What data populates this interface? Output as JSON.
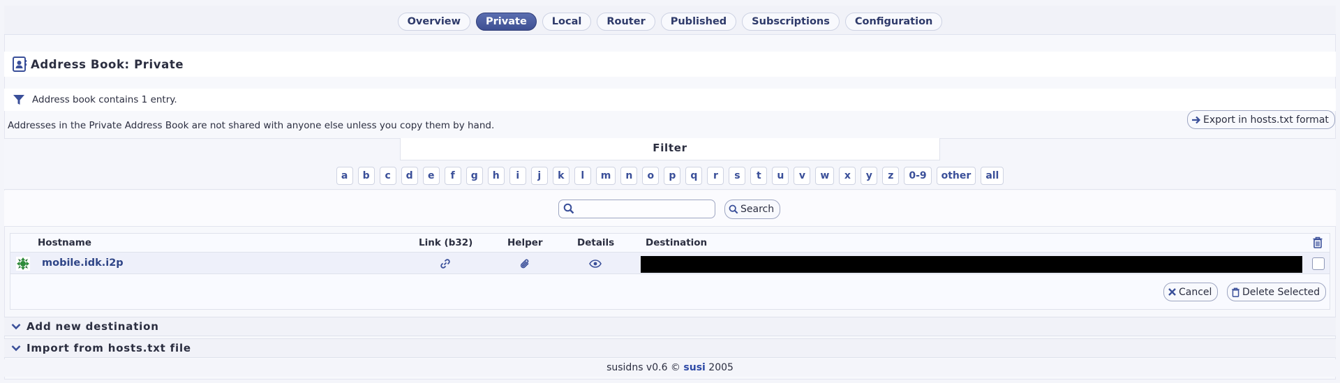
{
  "nav": {
    "tabs": [
      {
        "label": "Overview",
        "active": false
      },
      {
        "label": "Private",
        "active": true
      },
      {
        "label": "Local",
        "active": false
      },
      {
        "label": "Router",
        "active": false
      },
      {
        "label": "Published",
        "active": false
      },
      {
        "label": "Subscriptions",
        "active": false
      },
      {
        "label": "Configuration",
        "active": false
      }
    ]
  },
  "header": {
    "title": "Address Book: Private",
    "icon": "address-book-icon"
  },
  "info": {
    "text": "Address book contains 1 entry.",
    "icon": "filter-icon"
  },
  "notice": "Addresses in the Private Address Book are not shared with anyone else unless you copy them by hand.",
  "export_label": "Export in hosts.txt format",
  "filter": {
    "title": "Filter",
    "letters": [
      "a",
      "b",
      "c",
      "d",
      "e",
      "f",
      "g",
      "h",
      "i",
      "j",
      "k",
      "l",
      "m",
      "n",
      "o",
      "p",
      "q",
      "r",
      "s",
      "t",
      "u",
      "v",
      "w",
      "x",
      "y",
      "z",
      "0-9",
      "other",
      "all"
    ]
  },
  "search": {
    "value": "",
    "button_label": "Search"
  },
  "table": {
    "headers": {
      "hostname": "Hostname",
      "link": "Link (b32)",
      "helper": "Helper",
      "details": "Details",
      "destination": "Destination"
    },
    "rows": [
      {
        "hostname": "mobile.idk.i2p",
        "destination_redacted": true
      }
    ]
  },
  "actions": {
    "cancel": "Cancel",
    "delete": "Delete Selected"
  },
  "sections": {
    "add": "Add new destination",
    "import": "Import from hosts.txt file"
  },
  "footer": {
    "prefix": "susidns v0.6 ©",
    "link": "susi",
    "year": "2005"
  },
  "colors": {
    "accent": "#3e4f92",
    "link": "#2f4587",
    "icon": "#3a4f99"
  }
}
